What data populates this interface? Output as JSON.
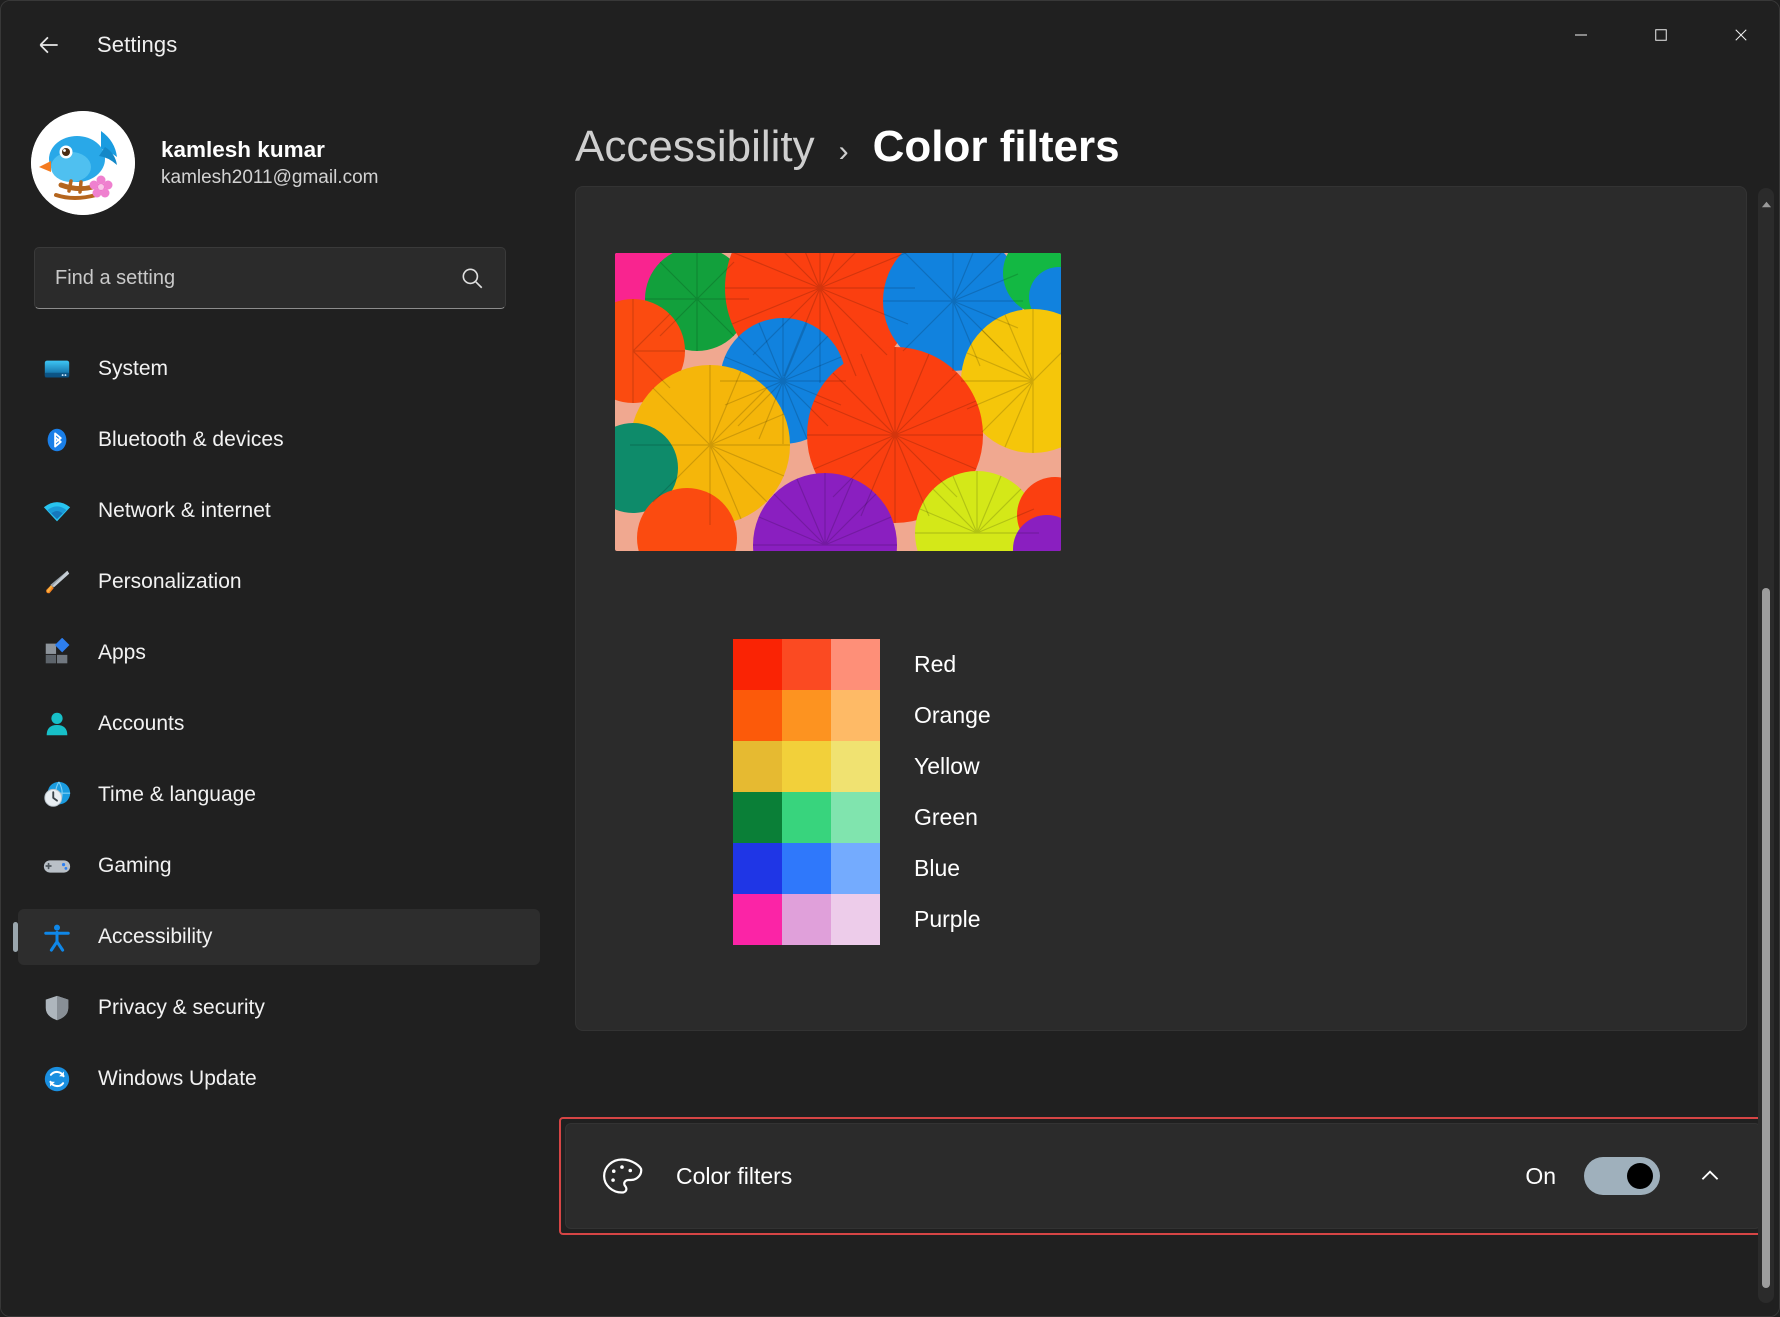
{
  "window": {
    "title": "Settings",
    "back_icon": "back-arrow-icon",
    "controls": [
      {
        "name": "minimize-button",
        "icon": "minimize-icon"
      },
      {
        "name": "maximize-button",
        "icon": "maximize-icon"
      },
      {
        "name": "close-button",
        "icon": "close-icon"
      }
    ]
  },
  "account": {
    "name": "kamlesh kumar",
    "email": "kamlesh2011@gmail.com",
    "avatar_icon": "bird-avatar-icon"
  },
  "search": {
    "placeholder": "Find a setting",
    "value": "",
    "icon": "search-icon"
  },
  "sidebar": {
    "items": [
      {
        "label": "System",
        "icon": "monitor-icon",
        "selected": false
      },
      {
        "label": "Bluetooth & devices",
        "icon": "bluetooth-icon",
        "selected": false
      },
      {
        "label": "Network & internet",
        "icon": "wifi-icon",
        "selected": false
      },
      {
        "label": "Personalization",
        "icon": "paintbrush-icon",
        "selected": false
      },
      {
        "label": "Apps",
        "icon": "apps-icon",
        "selected": false
      },
      {
        "label": "Accounts",
        "icon": "person-icon",
        "selected": false
      },
      {
        "label": "Time & language",
        "icon": "clock-globe-icon",
        "selected": false
      },
      {
        "label": "Gaming",
        "icon": "gamepad-icon",
        "selected": false
      },
      {
        "label": "Accessibility",
        "icon": "accessibility-person-icon",
        "selected": true
      },
      {
        "label": "Privacy & security",
        "icon": "shield-icon",
        "selected": false
      },
      {
        "label": "Windows Update",
        "icon": "update-refresh-icon",
        "selected": false
      }
    ]
  },
  "breadcrumb": {
    "parent": "Accessibility",
    "separator": "›",
    "current": "Color filters"
  },
  "preview": {
    "alt": "colorful-paper-fans-photo"
  },
  "color_swatches": {
    "rows": [
      {
        "label": "Red",
        "colors": [
          "#fa2304",
          "#fb4a22",
          "#fe8f78"
        ]
      },
      {
        "label": "Orange",
        "colors": [
          "#fc5a0a",
          "#fd9320",
          "#feba66"
        ]
      },
      {
        "label": "Yellow",
        "colors": [
          "#e6ba31",
          "#f2d03a",
          "#f0e271"
        ]
      },
      {
        "label": "Green",
        "colors": [
          "#0a7f37",
          "#38d47d",
          "#80e4ae"
        ]
      },
      {
        "label": "Blue",
        "colors": [
          "#1f36e6",
          "#2f78fb",
          "#74abfe"
        ]
      },
      {
        "label": "Purple",
        "colors": [
          "#fb24a6",
          "#e0a0da",
          "#edccea"
        ]
      }
    ]
  },
  "color_filters_setting": {
    "label": "Color filters",
    "icon": "palette-icon",
    "state_label": "On",
    "toggle_on": true,
    "toggle_track_color": "#9fb0bc",
    "expand_icon": "chevron-up-icon",
    "highlight_color": "#d64545"
  },
  "scrollbar": {
    "up_arrow_icon": "scroll-up-arrow-icon"
  }
}
